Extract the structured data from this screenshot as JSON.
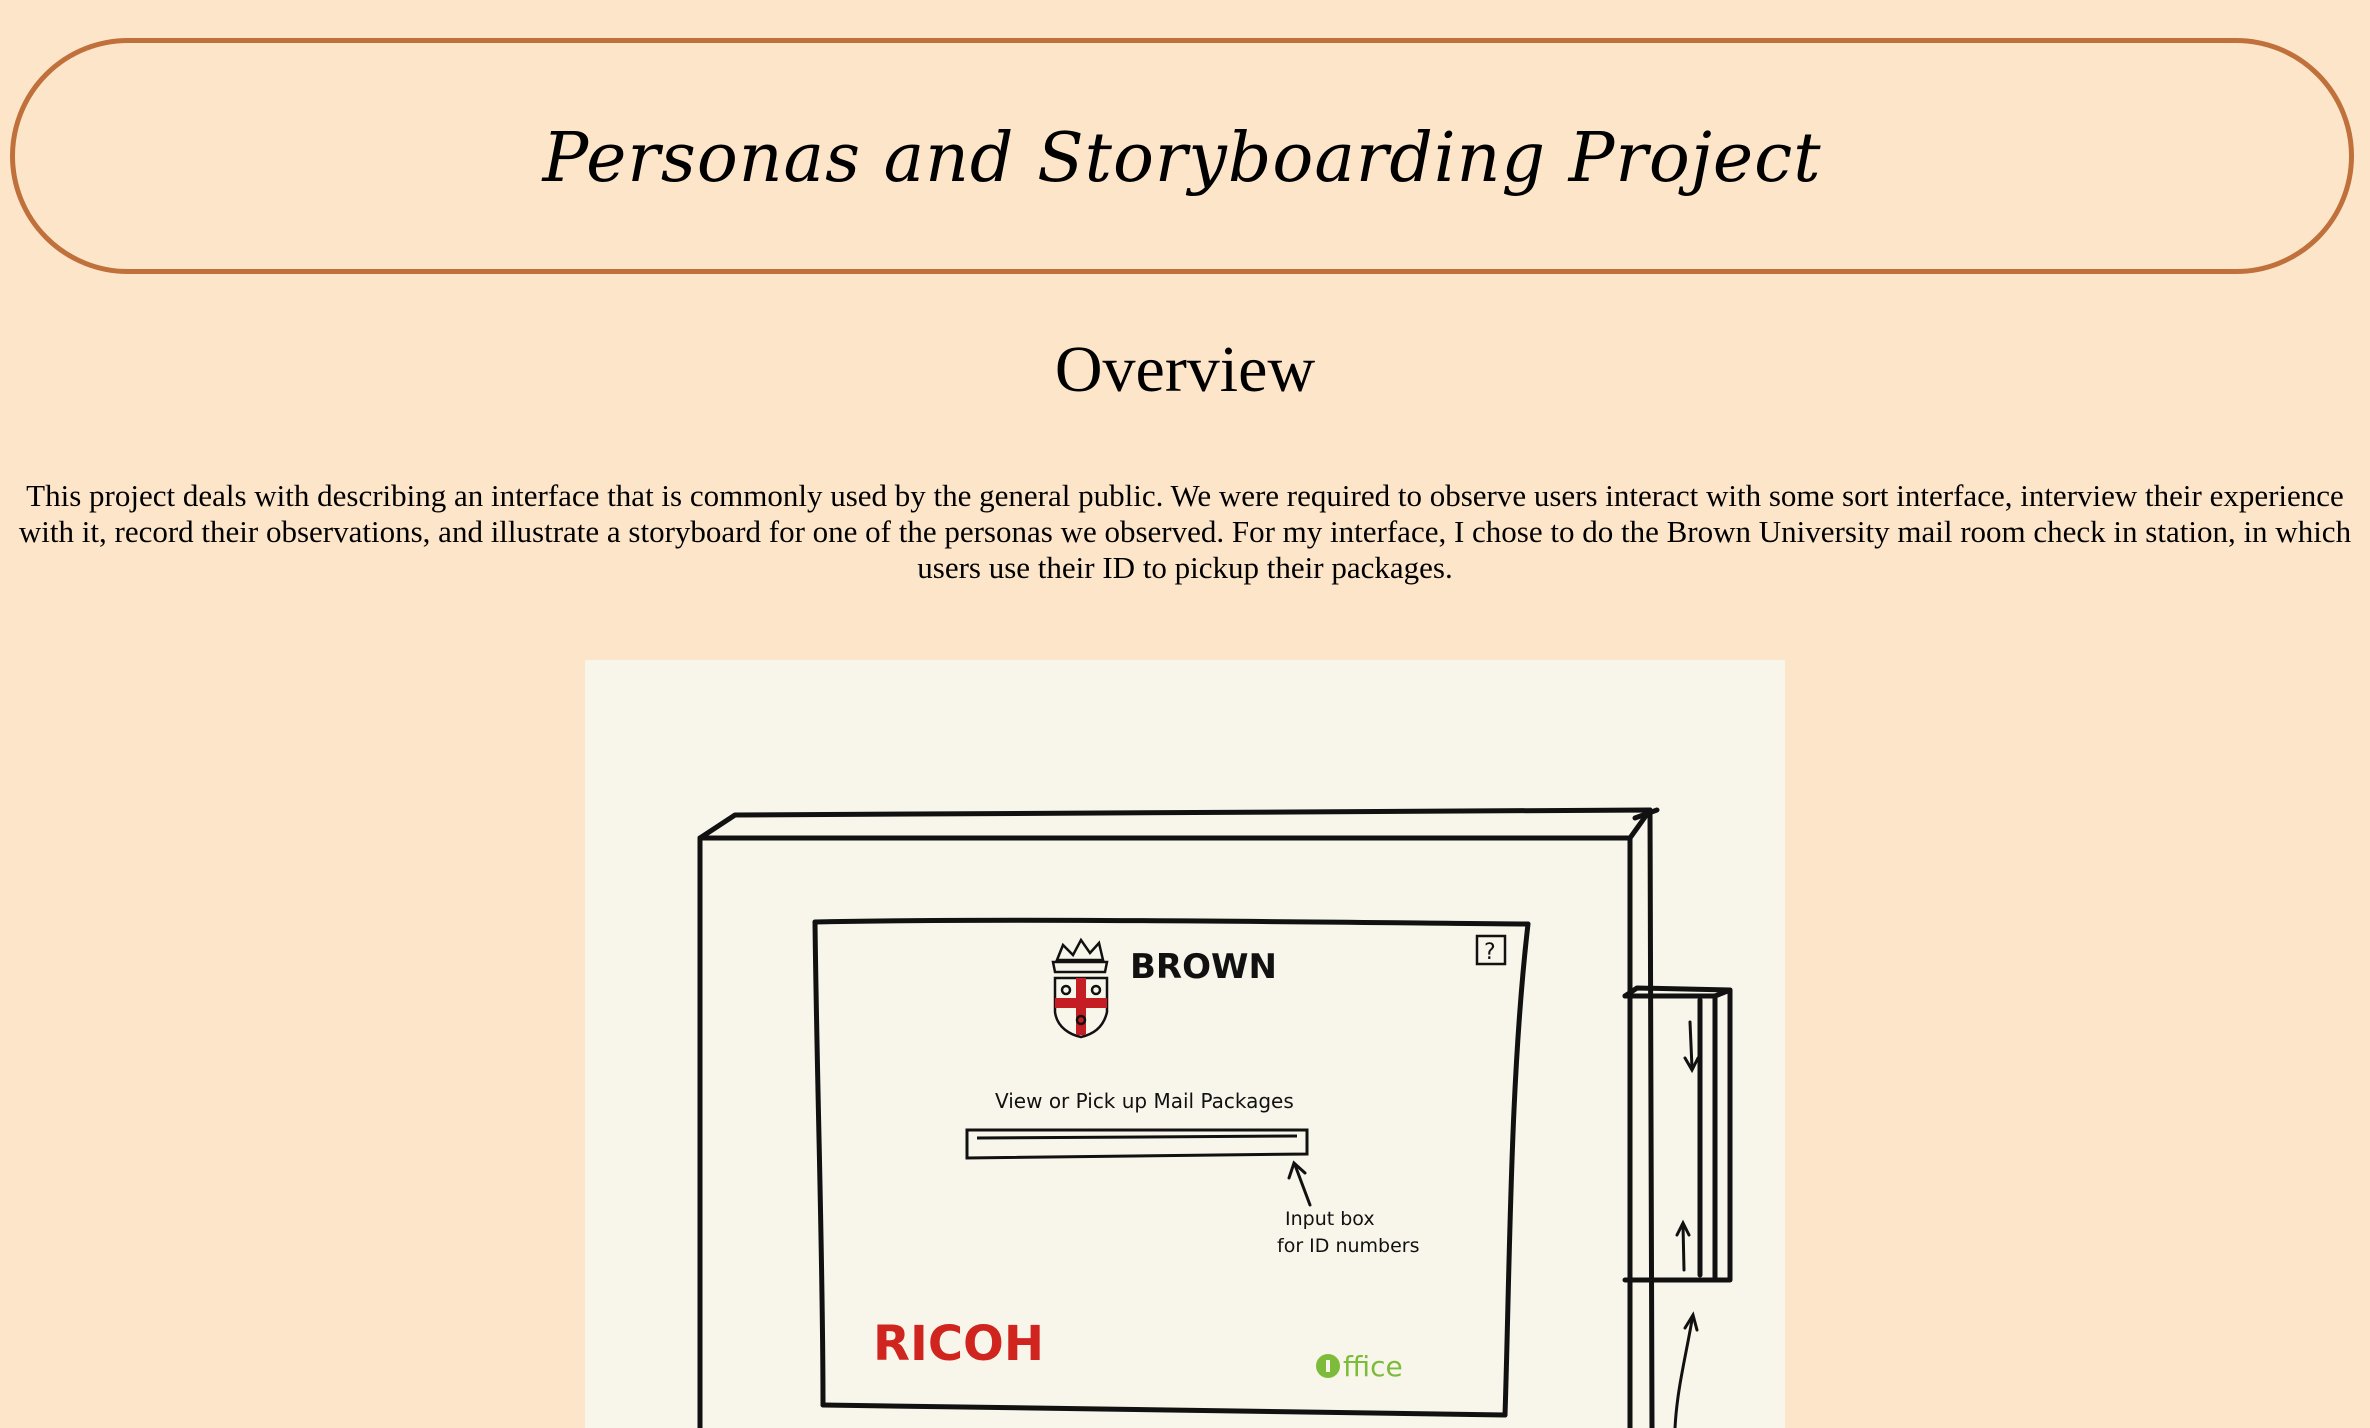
{
  "header": {
    "title": "Personas and Storyboarding Project"
  },
  "overview": {
    "heading": "Overview",
    "text": "This project deals with describing an interface that is commonly used by the general public. We were required to observe users interact with some sort interface, interview their experience with it, record their observations, and illustrate a storyboard for one of the personas we observed. For my interface, I chose to do the Brown University mail room check in station, in which users use their ID to pickup their packages."
  },
  "sketch": {
    "brand_text": "BROWN",
    "help_symbol": "?",
    "prompt_text": "View or Pick up Mail Packages",
    "annotation_line1": "Input box",
    "annotation_line2": "for ID numbers",
    "ricoh_logo": "RICOH",
    "office_logo": "ffice",
    "colors": {
      "ricoh_red": "#d0241e",
      "office_green": "#7dbb3a",
      "shield_red": "#c41e24"
    },
    "icons": [
      "brown-crest-icon",
      "help-icon",
      "arrow-up-icon",
      "arrow-down-icon",
      "office-logo-icon"
    ]
  }
}
